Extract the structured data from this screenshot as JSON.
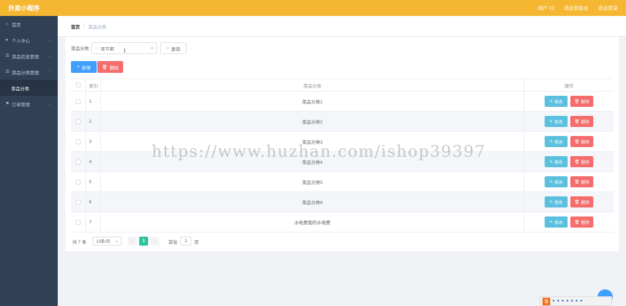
{
  "app": {
    "title": "外卖小程序"
  },
  "topbar": {
    "user": "用户 22",
    "logout": "退出到前台",
    "exit": "退出登录"
  },
  "sidebar": {
    "items": [
      {
        "label": "首页",
        "icon": "home-icon",
        "has_children": false
      },
      {
        "label": "个人中心",
        "icon": "user-icon",
        "has_children": true
      },
      {
        "label": "菜品信息管理",
        "icon": "menu-icon",
        "has_children": true
      },
      {
        "label": "菜品分类管理",
        "icon": "menu-icon",
        "has_children": true,
        "expanded": true
      }
    ],
    "sub_item": "菜品分类",
    "last_item": {
      "label": "订单管理",
      "icon": "flag-icon",
      "has_children": true
    }
  },
  "breadcrumb": {
    "home": "首页",
    "separator": "/",
    "current": "菜品分类"
  },
  "search": {
    "label": "菜品分类",
    "value": "双方都",
    "query_button": "查询"
  },
  "actions": {
    "add": "新增",
    "delete": "删除"
  },
  "table": {
    "headers": {
      "index": "索引",
      "name": "菜品分类",
      "ops": "操作"
    },
    "edit_label": "修改",
    "delete_label": "删除",
    "rows": [
      {
        "index": "1",
        "name": "菜品分类1"
      },
      {
        "index": "2",
        "name": "菜品分类2"
      },
      {
        "index": "3",
        "name": "菜品分类3"
      },
      {
        "index": "4",
        "name": "菜品分类4"
      },
      {
        "index": "5",
        "name": "菜品分类5"
      },
      {
        "index": "6",
        "name": "菜品分类6"
      },
      {
        "index": "7",
        "name": "水电费我的水电费"
      }
    ]
  },
  "pagination": {
    "total": "共 7 条",
    "page_size": "10条/页",
    "current_page": "1",
    "goto_label": "前往",
    "goto_value": "1",
    "page_unit": "页"
  },
  "watermark": "https://www.huzhan.com/ishop39397",
  "colors": {
    "header": "#f5b731",
    "sidebar": "#304156",
    "primary": "#409eff",
    "danger": "#f56c6c",
    "edit": "#5bc0de",
    "page_active": "#2fc4a0"
  }
}
